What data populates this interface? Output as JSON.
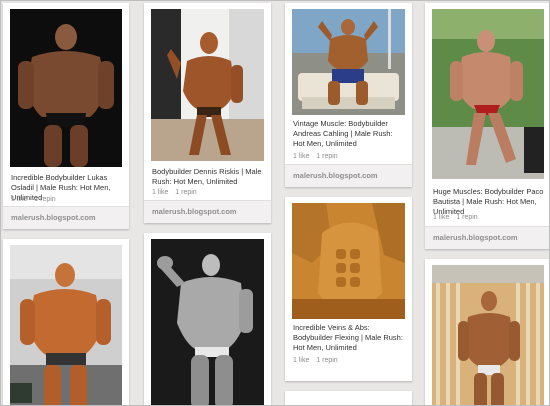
{
  "pins": [
    {
      "caption": "Incredible Bodybuilder Lukas Osladil | Male Rush: Hot Men, Unlimited",
      "likes": "1 like",
      "repins": "1 repin",
      "source": "malerush.blogspot.com"
    },
    {
      "caption": "Bodybuilder Dennis Riskis | Male Rush: Hot Men, Unlimited",
      "likes": "1 like",
      "repins": "1 repin",
      "source": "malerush.blogspot.com"
    },
    {
      "caption": "Vintage Muscle: Bodybuilder Andreas Cahling | Male Rush: Hot Men, Unlimited",
      "likes": "1 like",
      "repins": "1 repin",
      "source": "malerush.blogspot.com"
    },
    {
      "caption": "Huge Muscles: Bodybuilder Paco Bautista | Male Rush: Hot Men, Unlimited",
      "likes": "1 like",
      "repins": "1 repin",
      "source": "malerush.blogspot.com"
    },
    {
      "caption": "Incredible Veins & Abs: Bodybuilder Flexing | Male Rush: Hot Men, Unlimited",
      "likes": "1 like",
      "repins": "1 repin",
      "source": ""
    }
  ],
  "colors": {
    "background": "#e9e6e6",
    "card": "#ffffff",
    "source_bar": "#f2f0f0",
    "source_text": "#8f8f8f",
    "caption_text": "#333333",
    "stats_text": "#8c8c8c"
  }
}
